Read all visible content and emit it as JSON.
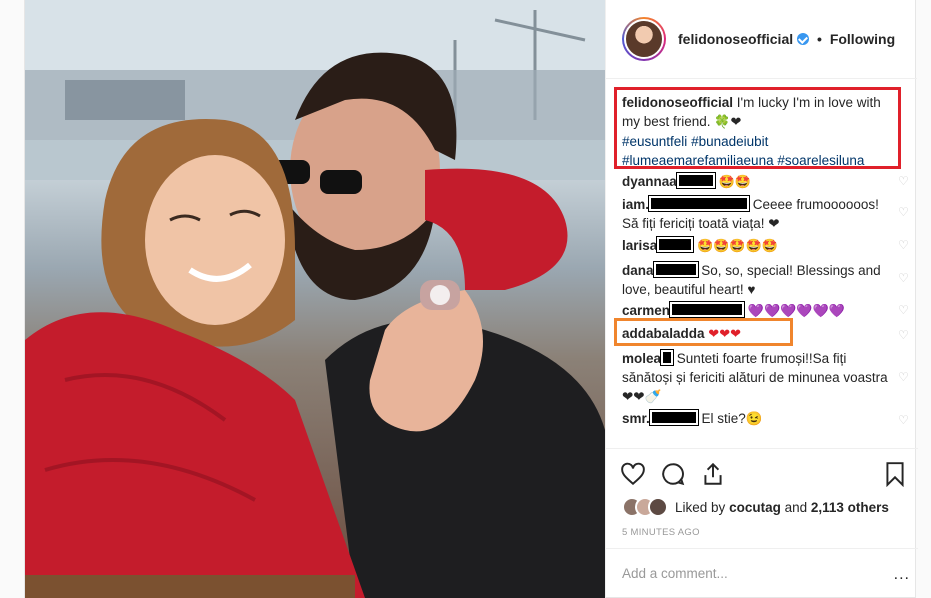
{
  "header": {
    "username": "felidonoseofficial",
    "separator": "•",
    "follow_status": "Following"
  },
  "caption": {
    "username": "felidonoseofficial",
    "text": "I'm lucky I'm in love with my best friend.",
    "emoji": "🍀❤",
    "hashtags": [
      "#eusuntfeli",
      "#bunadeiubit",
      "#lumeaemarefamiliaeuna",
      "#soarelesiluna"
    ]
  },
  "comments": [
    {
      "username": "dyannaa",
      "text": "🤩🤩"
    },
    {
      "username": "iam.",
      "text": "Ceeee frumoooooos! Să fiți fericiți toată viața! ❤"
    },
    {
      "username": "larisa",
      "text": "🤩🤩🤩🤩🤩"
    },
    {
      "username": "dana",
      "text": "So, so, special! Blessings and love, beautiful heart! ♥"
    },
    {
      "username": "carmen",
      "text": "💜💜💜💜💜💜"
    },
    {
      "username": "addabaladda",
      "text": "❤❤❤"
    },
    {
      "username": "molea",
      "text": "Sunteti foarte frumoși!!Sa fiți sănătoși și fericiti alături de minunea voastra❤❤🍼"
    },
    {
      "username": "smr.",
      "text": "El stie?😉"
    }
  ],
  "likes": {
    "prefix": "Liked by",
    "user": "cocutag",
    "and": "and",
    "count": "2,113 others"
  },
  "timestamp": "5 MINUTES AGO",
  "add_comment_placeholder": "Add a comment...",
  "more_options": "...",
  "colors": {
    "highlight_red": "#e0202a",
    "highlight_orange": "#f0852d",
    "hashtag_blue": "#003569",
    "verified_blue": "#3897f0"
  },
  "icons": [
    "heart-icon",
    "comment-icon",
    "share-icon",
    "bookmark-icon",
    "verified-icon"
  ]
}
